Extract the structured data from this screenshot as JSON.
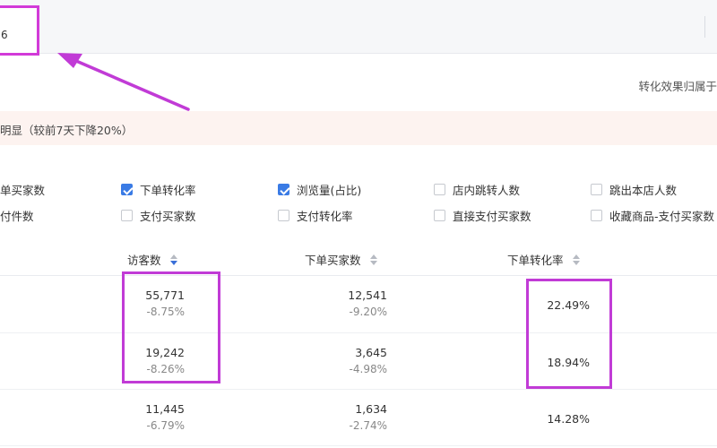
{
  "top": {
    "input_value": "6"
  },
  "attribution_text": "转化效果归属于",
  "alert_text": "明显（较前7天下降20%）",
  "metrics": [
    {
      "label": "单买家数",
      "checked": false,
      "show_box": false
    },
    {
      "label": "下单转化率",
      "checked": true,
      "show_box": true
    },
    {
      "label": "浏览量(占比)",
      "checked": true,
      "show_box": true
    },
    {
      "label": "店内跳转人数",
      "checked": false,
      "show_box": true
    },
    {
      "label": "跳出本店人数",
      "checked": false,
      "show_box": true
    },
    {
      "label": "付件数",
      "checked": false,
      "show_box": false
    },
    {
      "label": "支付买家数",
      "checked": false,
      "show_box": true
    },
    {
      "label": "支付转化率",
      "checked": false,
      "show_box": true
    },
    {
      "label": "直接支付买家数",
      "checked": false,
      "show_box": true
    },
    {
      "label": "收藏商品-支付买家数",
      "checked": false,
      "show_box": true
    }
  ],
  "table": {
    "headers": [
      {
        "label": "访客数",
        "sort": "desc"
      },
      {
        "label": "下单买家数",
        "sort": "none"
      },
      {
        "label": "下单转化率",
        "sort": "none"
      }
    ],
    "rows": [
      {
        "visitors": "55,771",
        "visitors_change": "-8.75%",
        "buyers": "12,541",
        "buyers_change": "-9.20%",
        "rate": "22.49%"
      },
      {
        "visitors": "19,242",
        "visitors_change": "-8.26%",
        "buyers": "3,645",
        "buyers_change": "-4.98%",
        "rate": "18.94%"
      },
      {
        "visitors": "11,445",
        "visitors_change": "-6.79%",
        "buyers": "1,634",
        "buyers_change": "-2.74%",
        "rate": "14.28%"
      }
    ]
  },
  "colors": {
    "highlight": "#c13bd6",
    "checkbox_checked": "#3a7be5",
    "alert_bg": "#fdf3f0"
  }
}
